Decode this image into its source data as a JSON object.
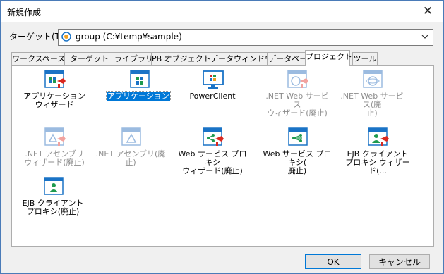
{
  "window": {
    "title": "新規作成",
    "close_glyph": "✕"
  },
  "target": {
    "label": "ターゲット(T):",
    "value": "group (C:¥temp¥sample)"
  },
  "tabs": [
    {
      "label": "ワークスペース"
    },
    {
      "label": "ターゲット"
    },
    {
      "label": "ライブラリ"
    },
    {
      "label": "PB オブジェクト"
    },
    {
      "label": "データウィンドウ"
    },
    {
      "label": "データベース"
    },
    {
      "label": "プロジェクト",
      "active": true
    },
    {
      "label": "ツール"
    }
  ],
  "items": [
    {
      "label": "アプリケーション\nウィザード",
      "icon": "application-wizard-icon",
      "enabled": true
    },
    {
      "label": "アプリケーション",
      "icon": "application-icon",
      "enabled": true,
      "selected": true
    },
    {
      "label": "PowerClient",
      "icon": "powerclient-icon",
      "enabled": true
    },
    {
      "label": ".NET Web サービス\nウィザード(廃止)",
      "icon": "dotnet-web-service-wizard-icon",
      "enabled": false
    },
    {
      "label": ".NET Web サービス(廃\n止)",
      "icon": "dotnet-web-service-icon",
      "enabled": false
    },
    {
      "label": ".NET アセンブリ\nウィザード(廃止)",
      "icon": "dotnet-assembly-wizard-icon",
      "enabled": false
    },
    {
      "label": ".NET アセンブリ(廃止)",
      "icon": "dotnet-assembly-icon",
      "enabled": false
    },
    {
      "label": "Web サービス プロキシ\nウィザード(廃止)",
      "icon": "web-service-proxy-wizard-icon",
      "enabled": true
    },
    {
      "label": "Web サービス プロキシ(\n廃止)",
      "icon": "web-service-proxy-icon",
      "enabled": true
    },
    {
      "label": "EJB クライアント\nプロキシ ウィザード(...",
      "icon": "ejb-client-proxy-wizard-icon",
      "enabled": true
    },
    {
      "label": "EJB クライアント\nプロキシ(廃止)",
      "icon": "ejb-client-proxy-icon",
      "enabled": true
    }
  ],
  "buttons": {
    "ok": "OK",
    "cancel": "キャンセル"
  },
  "colors": {
    "accent": "#0078d7",
    "icon_blue": "#1a73c6",
    "icon_green": "#1f9a4e",
    "icon_red": "#d9281f",
    "disabled": "#8c8c8c"
  }
}
